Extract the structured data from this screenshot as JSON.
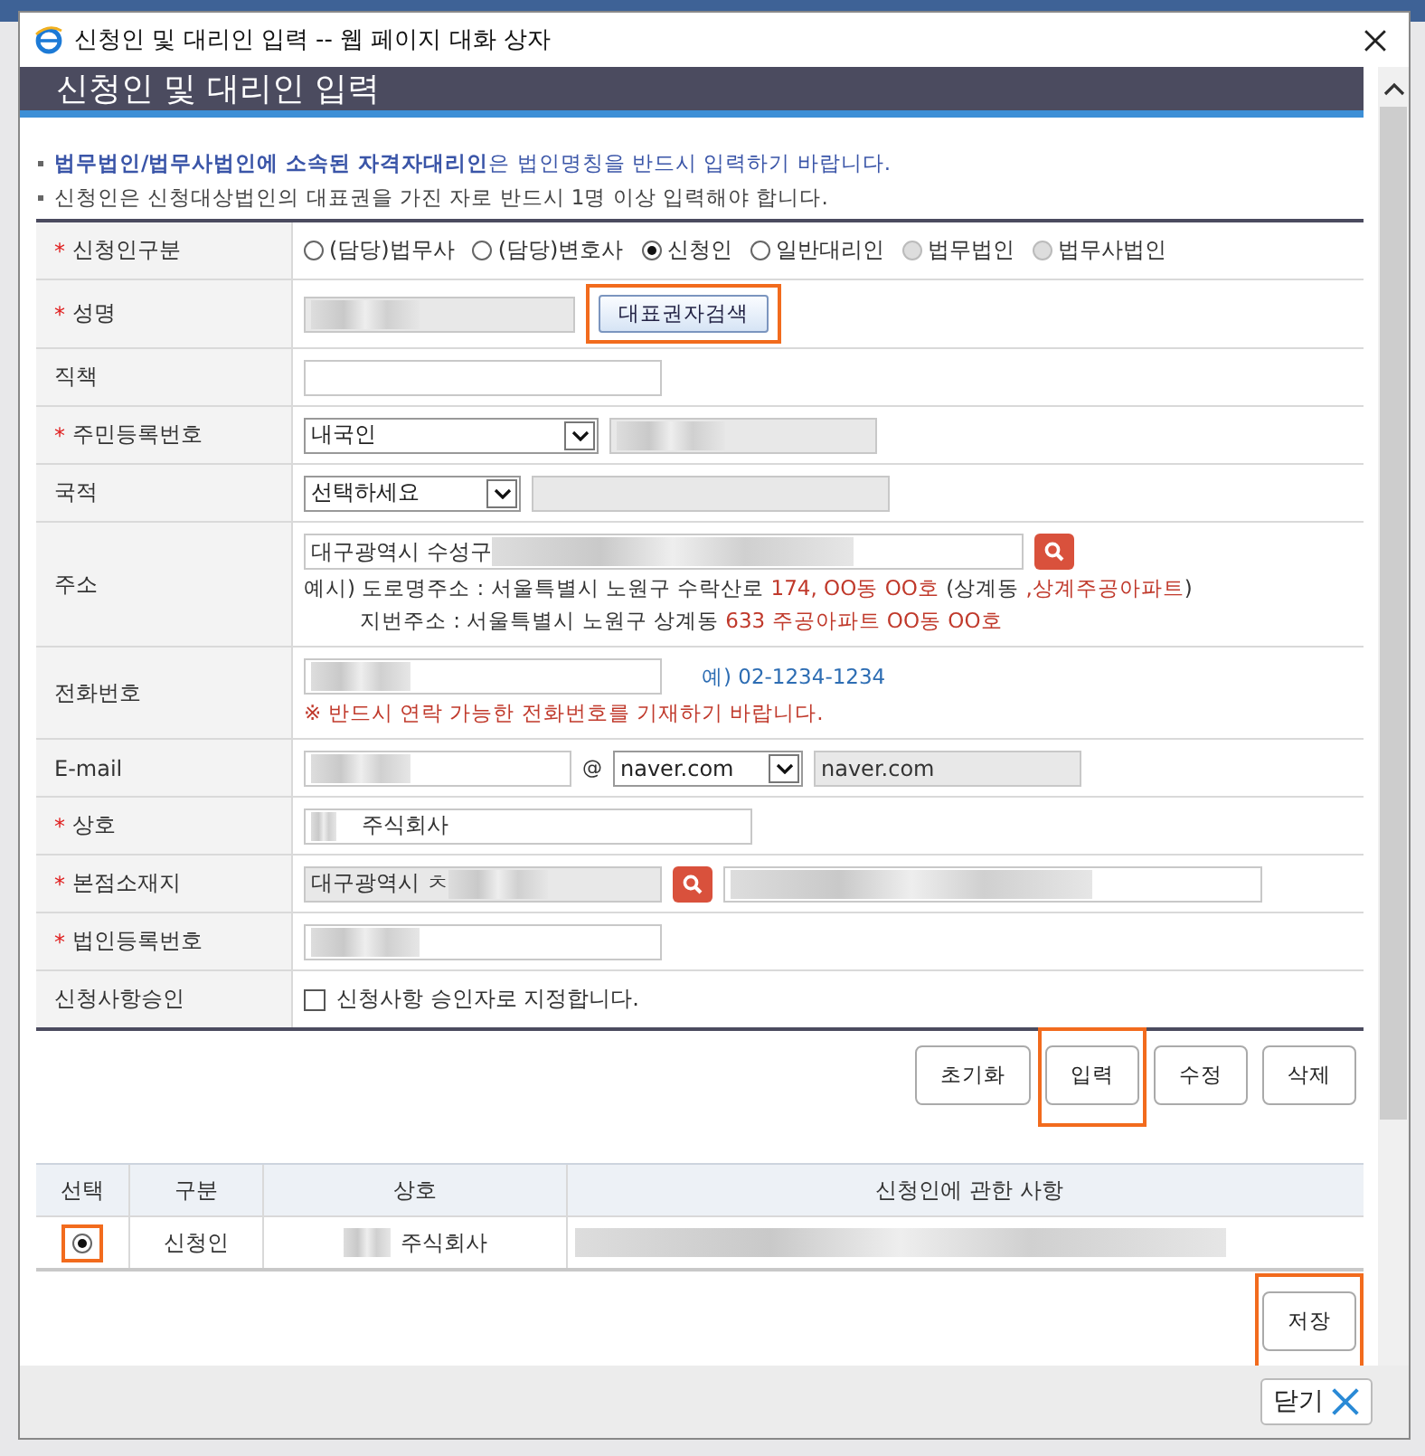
{
  "window": {
    "title": "신청인 및 대리인 입력 -- 웹 페이지 대화 상자"
  },
  "header": {
    "title": "신청인 및 대리인 입력"
  },
  "notices": [
    {
      "kind": "highlight",
      "text": "**법무법인/법무사법인에 소속된 자격자대리인**은 법인명칭을 반드시 입력하기 바랍니다."
    },
    {
      "kind": "plain",
      "text": "신청인은 신청대상법인의 대표권을 가진 자로 반드시 1명 이상 입력해야 합니다."
    }
  ],
  "form": [
    {
      "kind": "radios",
      "mark": "*",
      "label": "신청인구분",
      "options": [
        {
          "label": "(담당)법무사",
          "selected": false,
          "disabled": false
        },
        {
          "label": "(담당)변호사",
          "selected": false,
          "disabled": false
        },
        {
          "label": "신청인",
          "selected": true,
          "disabled": false
        },
        {
          "label": "일반대리인",
          "selected": false,
          "disabled": false
        },
        {
          "label": "법무법인",
          "selected": false,
          "disabled": true
        },
        {
          "label": "법무사법인",
          "selected": false,
          "disabled": true
        }
      ]
    },
    {
      "kind": "name",
      "mark": "*",
      "label": "성명",
      "button": {
        "label": "대표권자검색",
        "highlighted": true
      }
    },
    {
      "kind": "text",
      "label": "직책"
    },
    {
      "kind": "select-id",
      "mark": "*",
      "label": "주민등록번호",
      "select": "내국인"
    },
    {
      "kind": "select",
      "label": "국적",
      "select": "선택하세요"
    },
    {
      "kind": "address",
      "label": "주소",
      "value": "대구광역시 수성구",
      "examples": [
        "예시) 도로명주소 : 서울특별시 노원구 수락산로 *174, OO동 OO호* (상계동 *,상계주공아파트*)",
        "지번주소 : 서울특별시 노원구 상계동 *633 주공아파트 OO동 OO호*"
      ]
    },
    {
      "kind": "phone",
      "label": "전화번호",
      "hint": "예) 02-1234-1234",
      "warning": "※ 반드시 연락 가능한 전화번호를 기재하기 바랍니다."
    },
    {
      "kind": "email",
      "label": "E-mail",
      "at": "@",
      "select": "naver.com",
      "domain": "naver.com"
    },
    {
      "kind": "company",
      "mark": "*",
      "label": "상호",
      "value": "주식회사"
    },
    {
      "kind": "office",
      "mark": "*",
      "label": "본점소재지",
      "value": "대구광역시 ㅊ"
    },
    {
      "kind": "blurred",
      "mark": "*",
      "label": "법인등록번호"
    },
    {
      "kind": "checkbox",
      "label": "신청사항승인",
      "checked": false,
      "text": "신청사항 승인자로 지정합니다."
    }
  ],
  "actions": [
    {
      "label": "초기화",
      "highlighted": false
    },
    {
      "label": "입력",
      "highlighted": true
    },
    {
      "label": "수정",
      "highlighted": false
    },
    {
      "label": "삭제",
      "highlighted": false
    }
  ],
  "table": {
    "columns": [
      "선택",
      "구분",
      "상호",
      "신청인에 관한 사항"
    ],
    "rows": [
      {
        "selected": true,
        "highlighted": true,
        "type": "신청인",
        "company": "주식회사"
      }
    ]
  },
  "save": {
    "label": "저장",
    "highlighted": true
  },
  "footer": {
    "close": "닫기"
  }
}
